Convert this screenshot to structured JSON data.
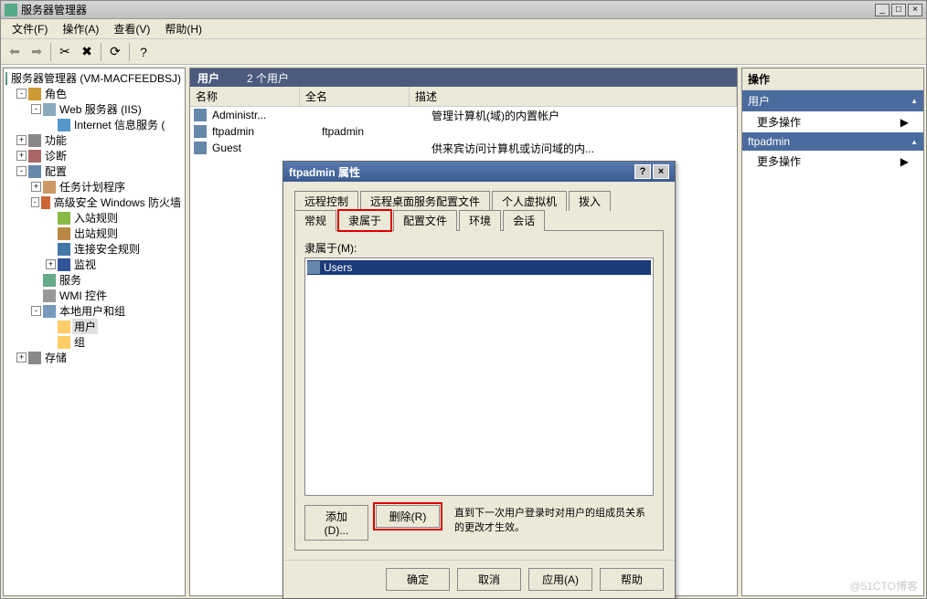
{
  "window": {
    "title": "服务器管理器"
  },
  "menu": {
    "file": "文件(F)",
    "action": "操作(A)",
    "view": "查看(V)",
    "help": "帮助(H)"
  },
  "tree": {
    "root": "服务器管理器 (VM-MACFEEDBSJ)",
    "roles": "角色",
    "web": "Web 服务器 (IIS)",
    "iis": "Internet 信息服务 (",
    "features": "功能",
    "diag": "诊断",
    "conf": "配置",
    "task": "任务计划程序",
    "fw": "高级安全 Windows 防火墙",
    "inbound": "入站规则",
    "outbound": "出站规则",
    "connsec": "连接安全规则",
    "monitor": "监视",
    "services": "服务",
    "wmi": "WMI 控件",
    "localug": "本地用户和组",
    "users": "用户",
    "groups": "组",
    "storage": "存储"
  },
  "mid": {
    "title": "用户",
    "count": "2 个用户",
    "col_name": "名称",
    "col_full": "全名",
    "col_desc": "描述",
    "rows": [
      {
        "name": "Administr...",
        "full": "",
        "desc": "管理计算机(域)的内置帐户"
      },
      {
        "name": "ftpadmin",
        "full": "ftpadmin",
        "desc": ""
      },
      {
        "name": "Guest",
        "full": "",
        "desc": "供来宾访问计算机或访问域的内..."
      }
    ]
  },
  "actions": {
    "title": "操作",
    "users": "用户",
    "more": "更多操作",
    "ftpadmin": "ftpadmin"
  },
  "dialog": {
    "title": "ftpadmin 属性",
    "tabs_row1": [
      "远程控制",
      "远程桌面服务配置文件",
      "个人虚拟机",
      "拨入"
    ],
    "tabs_row2": [
      "常规",
      "隶属于",
      "配置文件",
      "环境",
      "会话"
    ],
    "member_label": "隶属于(M):",
    "member_item": "Users",
    "add": "添加(D)...",
    "remove": "删除(R)",
    "note": "直到下一次用户登录时对用户的组成员关系的更改才生效。",
    "ok": "确定",
    "cancel": "取消",
    "apply": "应用(A)",
    "help": "帮助"
  },
  "watermark": "@51CTO博客"
}
